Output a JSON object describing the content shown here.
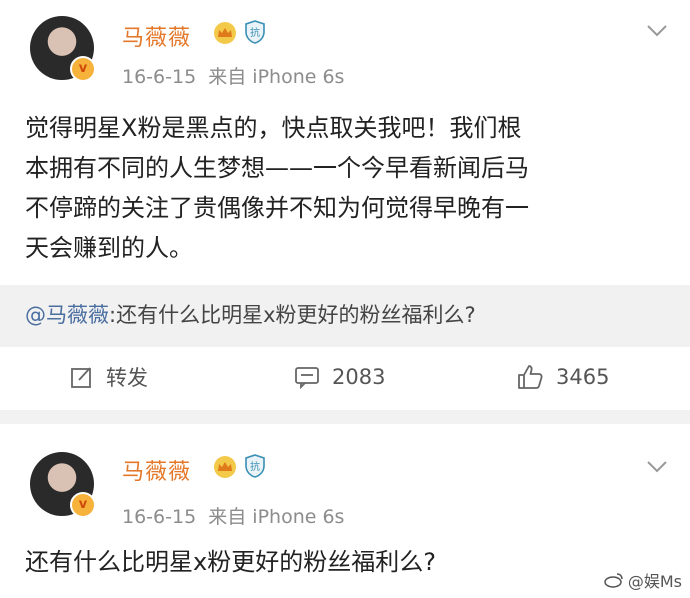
{
  "posts": [
    {
      "username": "马薇薇",
      "time": "16-6-15",
      "source": "来自 iPhone 6s",
      "badge_text": "抗",
      "verified_mark": "v",
      "text_lines": [
        "觉得明星X粉是黑点的，快点取关我吧！我们根",
        "本拥有不同的人生梦想——一个今早看新闻后马",
        "不停蹄的关注了贵偶像并不知为何觉得早晚有一",
        "天会赚到的人。"
      ],
      "repost": {
        "mention": "@马薇薇",
        "text": ":还有什么比明星x粉更好的粉丝福利么?"
      },
      "actions": {
        "repost_label": "转发",
        "comment_count": "2083",
        "like_count": "3465"
      }
    },
    {
      "username": "马薇薇",
      "time": "16-6-15",
      "source": "来自 iPhone 6s",
      "badge_text": "抗",
      "verified_mark": "v",
      "text": "还有什么比明星x粉更好的粉丝福利么?"
    }
  ],
  "watermark": "@娱Ms",
  "colors": {
    "username": "#e4782a",
    "mention": "#4a6ea0",
    "meta": "#8c8c8c"
  }
}
